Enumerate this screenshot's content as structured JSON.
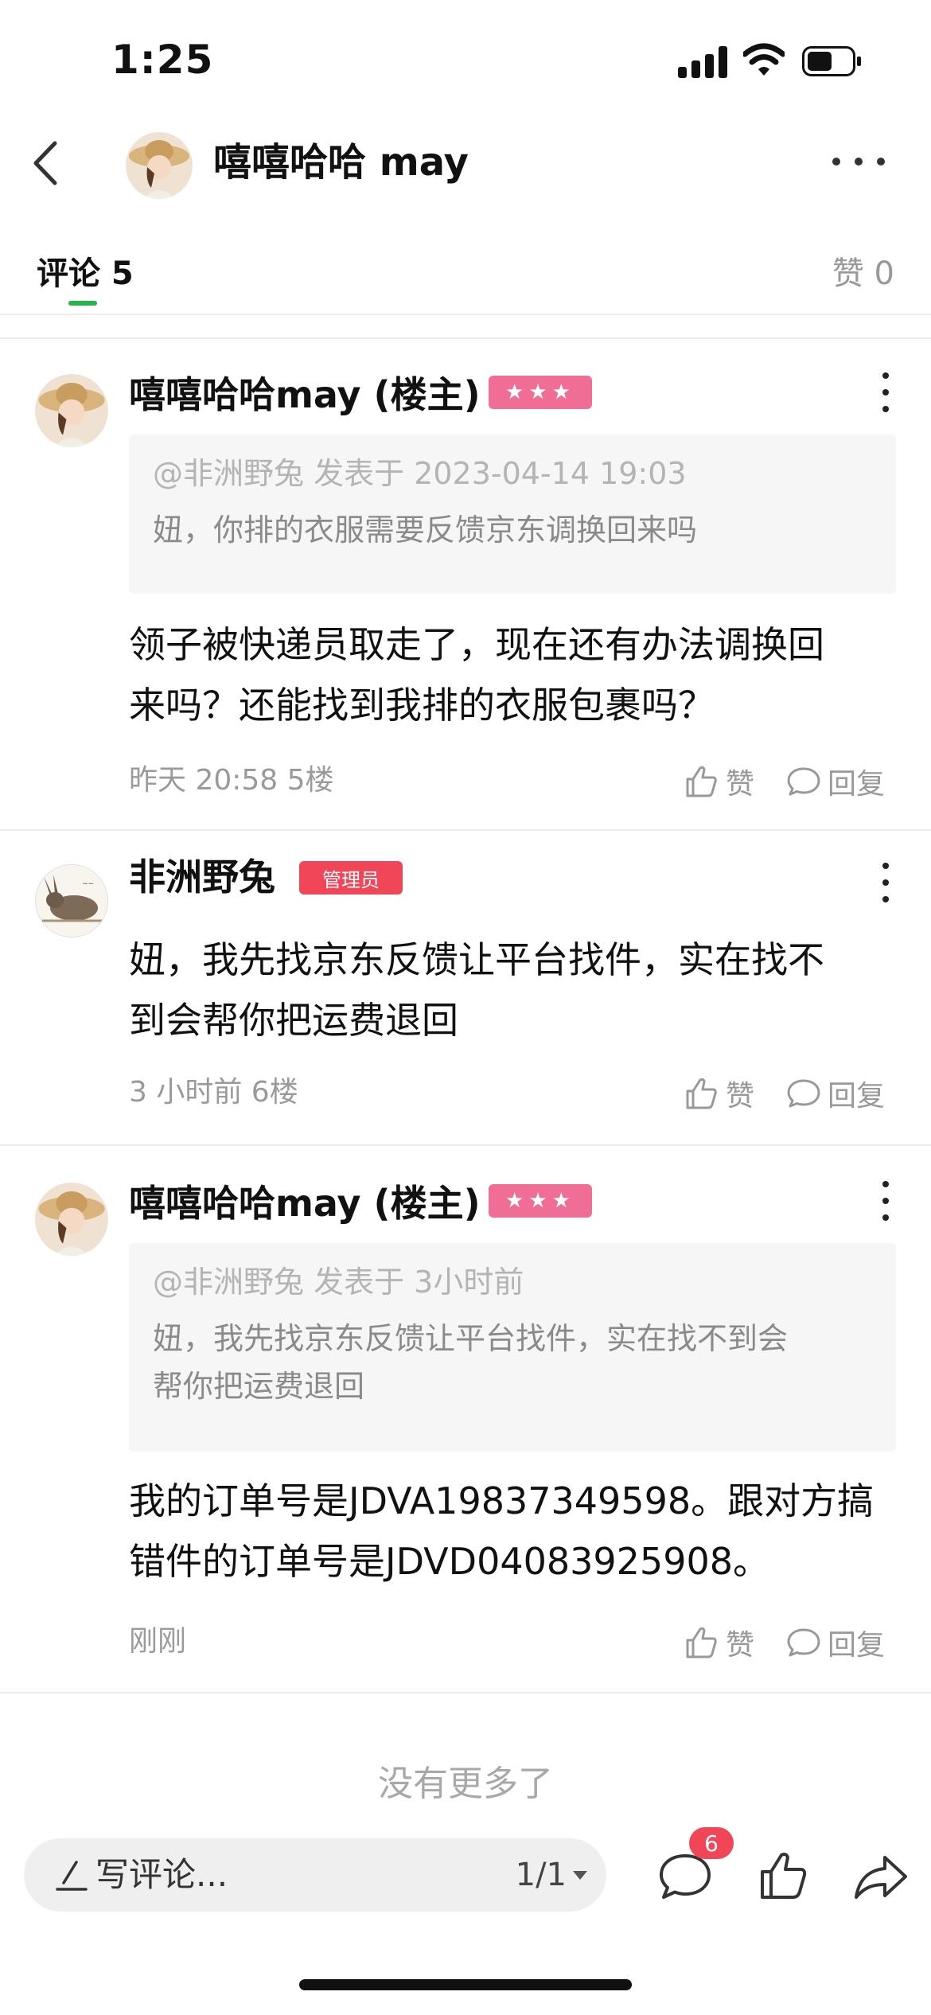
{
  "status_bar": {
    "time": "1:25"
  },
  "header": {
    "title": "嘻嘻哈哈 may"
  },
  "tabs": {
    "comments_label": "评论 5",
    "likes_label": "赞 0"
  },
  "comments": [
    {
      "author": "嘻嘻哈哈may (楼主)",
      "badge": "★★★",
      "quote_header": "@非洲野兔 发表于 2023-04-14 19:03",
      "quote_body": "妞，你排的衣服需要反馈京东调换回来吗",
      "body_line1": "领子被快递员取走了，现在还有办法调换回",
      "body_line2": "来吗？还能找到我排的衣服包裹吗？",
      "meta": "昨天 20:58  5楼",
      "like_label": "赞",
      "reply_label": "回复"
    },
    {
      "author": "非洲野兔",
      "badge": "管理员",
      "body_line1": "妞，我先找京东反馈让平台找件，实在找不",
      "body_line2": "到会帮你把运费退回",
      "meta": "3 小时前  6楼",
      "like_label": "赞",
      "reply_label": "回复"
    },
    {
      "author": "嘻嘻哈哈may (楼主)",
      "badge": "★★★",
      "quote_header": "@非洲野兔 发表于 3小时前",
      "quote_body_line1": "妞，我先找京东反馈让平台找件，实在找不到会",
      "quote_body_line2": "帮你把运费退回",
      "body_line1": "我的订单号是JDVA19837349598。跟对方搞",
      "body_line2": "错件的订单号是JDVD04083925908。",
      "meta": "刚刚",
      "like_label": "赞",
      "reply_label": "回复"
    }
  ],
  "footer": {
    "no_more": "没有更多了"
  },
  "bottom_bar": {
    "input_placeholder": "写评论...",
    "page_indicator": "1/1",
    "comment_count": "6",
    "icons": [
      "pencil-icon",
      "comment-icon",
      "thumbs-up-icon",
      "share-icon"
    ]
  },
  "colors": {
    "accent_green": "#26b54a",
    "star_badge": "#f06e95",
    "admin_badge": "#f04658"
  }
}
